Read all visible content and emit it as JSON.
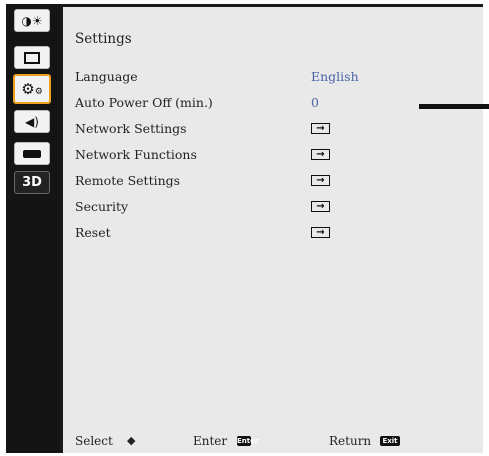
{
  "panel": {
    "title": "Settings"
  },
  "sidebar": {
    "items": [
      {
        "icon": "picture-brightness-icon"
      },
      {
        "icon": "screen-icon"
      },
      {
        "icon": "gears-icon",
        "active": true
      },
      {
        "icon": "speaker-icon"
      },
      {
        "icon": "projector-icon"
      },
      {
        "icon": "3d-icon",
        "label": "3D"
      }
    ]
  },
  "menu": {
    "rows": [
      {
        "label": "Language",
        "value": "English"
      },
      {
        "label": "Auto Power Off (min.)",
        "value": "0"
      },
      {
        "label": "Network Settings",
        "icon": "enter-arrow-icon"
      },
      {
        "label": "Network Functions",
        "icon": "enter-arrow-icon"
      },
      {
        "label": "Remote Settings",
        "icon": "enter-arrow-icon"
      },
      {
        "label": "Security",
        "icon": "enter-arrow-icon"
      },
      {
        "label": "Reset",
        "icon": "enter-arrow-icon"
      }
    ]
  },
  "footer": {
    "select": "Select",
    "enter": "Enter",
    "enter_key": "Enter",
    "return": "Return",
    "exit_key": "Exit"
  }
}
